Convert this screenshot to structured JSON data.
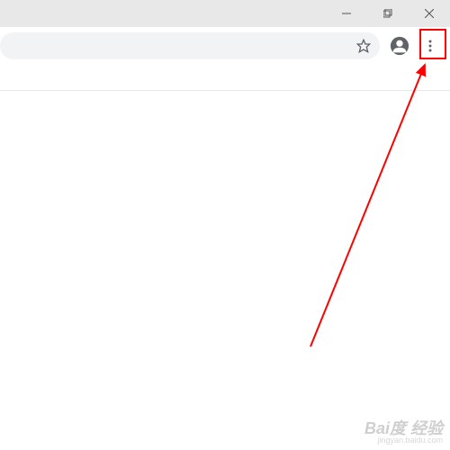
{
  "window": {
    "minimize": "minimize",
    "maximize": "maximize",
    "close": "close"
  },
  "toolbar": {
    "bookmark": "bookmark",
    "profile": "profile",
    "menu": "menu"
  },
  "annotation": {
    "highlight_color": "#ff0000",
    "arrow_color": "#ff0000"
  },
  "watermark": {
    "main": "Bai度 经验",
    "sub": "jingyan.baidu.com"
  }
}
